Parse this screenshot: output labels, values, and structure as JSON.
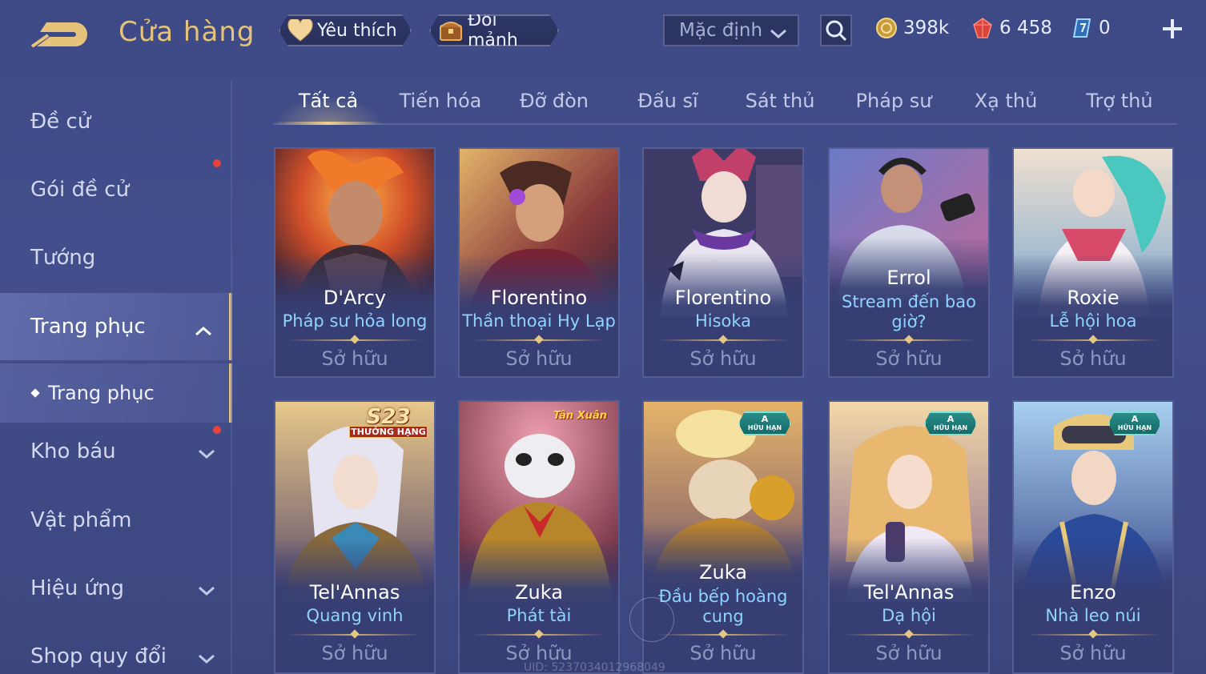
{
  "header": {
    "title": "Cửa hàng",
    "favorite_label": "Yêu thích",
    "shard_label": "Đổi mảnh",
    "sort_value": "Mặc định",
    "currencies": {
      "gold": "398k",
      "ruby": "6 458",
      "voucher": "0"
    }
  },
  "sidebar": {
    "items": [
      {
        "label": "Đề cử"
      },
      {
        "label": "Gói đề cử"
      },
      {
        "label": "Tướng"
      },
      {
        "label": "Trang phục"
      },
      {
        "label": "Trang phục"
      },
      {
        "label": "Kho báu"
      },
      {
        "label": "Vật phẩm"
      },
      {
        "label": "Hiệu ứng"
      },
      {
        "label": "Shop quy đổi"
      }
    ]
  },
  "tabs": [
    {
      "label": "Tất cả"
    },
    {
      "label": "Tiến hóa"
    },
    {
      "label": "Đỡ đòn"
    },
    {
      "label": "Đấu sĩ"
    },
    {
      "label": "Sát thủ"
    },
    {
      "label": "Pháp sư"
    },
    {
      "label": "Xạ thủ"
    },
    {
      "label": "Trợ thủ"
    }
  ],
  "cards": [
    {
      "hero": "D'Arcy",
      "skin": "Pháp sư hỏa long",
      "status": "Sở hữu"
    },
    {
      "hero": "Florentino",
      "skin": "Thần thoại Hy Lạp",
      "status": "Sở hữu"
    },
    {
      "hero": "Florentino",
      "skin": "Hisoka",
      "status": "Sở hữu"
    },
    {
      "hero": "Errol",
      "skin": "Stream đến bao giờ?",
      "status": "Sở hữu"
    },
    {
      "hero": "Roxie",
      "skin": "Lễ hội hoa",
      "status": "Sở hữu"
    },
    {
      "hero": "Tel'Annas",
      "skin": "Quang vinh",
      "status": "Sở hữu"
    },
    {
      "hero": "Zuka",
      "skin": "Phát tài",
      "status": "Sở hữu"
    },
    {
      "hero": "Zuka",
      "skin": "Đầu bếp hoàng cung",
      "status": "Sở hữu"
    },
    {
      "hero": "Tel'Annas",
      "skin": "Dạ hội",
      "status": "Sở hữu"
    },
    {
      "hero": "Enzo",
      "skin": "Nhà leo núi",
      "status": "Sở hữu"
    }
  ],
  "badges": {
    "season": "S23",
    "season_rank": "THƯỞNG HẠNG",
    "limited_letter": "A",
    "limited_text": "HỮU HẠN",
    "cny": "Tân Xuân"
  },
  "uid": "UID: 5237034012968049",
  "colors": {
    "background": "#404b88",
    "gold_accent": "#e4c27a",
    "skin_name": "#8fd3ff",
    "notification": "#e8443c"
  }
}
